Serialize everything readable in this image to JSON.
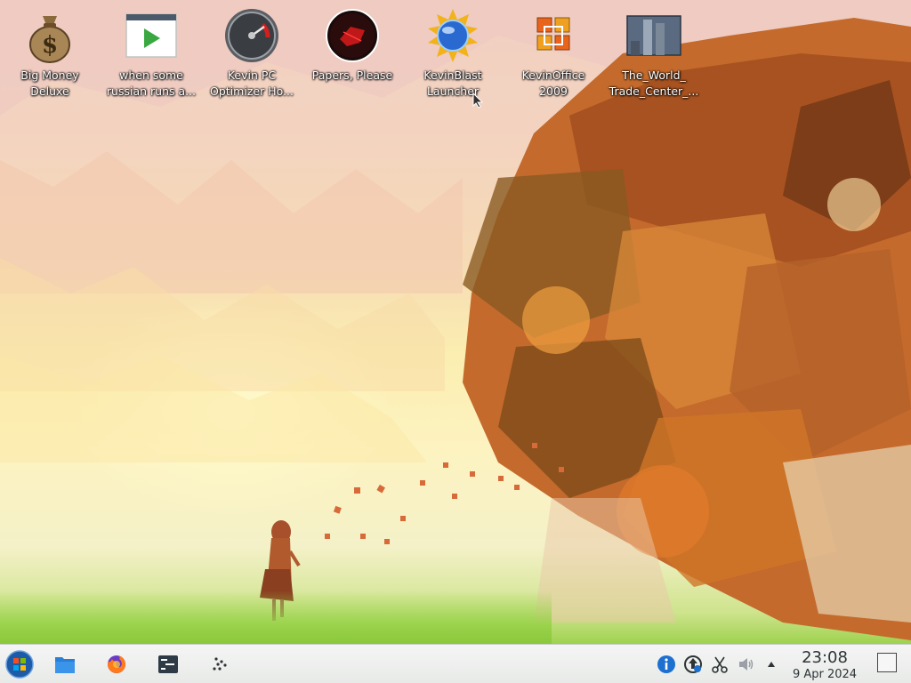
{
  "desktop": {
    "icons": [
      {
        "label": "Big Money\nDeluxe",
        "icon": "money-bag-icon"
      },
      {
        "label": "when some\nrussian runs a...",
        "icon": "video-file-icon"
      },
      {
        "label": "Kevin PC\nOptimizer Ho...",
        "icon": "gauge-icon"
      },
      {
        "label": "Papers, Please",
        "icon": "papers-please-icon"
      },
      {
        "label": "KevinBlast\nLauncher",
        "icon": "kevinblast-icon"
      },
      {
        "label": "KevinOffice\n2009",
        "icon": "office-icon"
      },
      {
        "label": "The_World_\nTrade_Center_...",
        "icon": "image-file-icon"
      }
    ]
  },
  "taskbar": {
    "start": {
      "icon": "start-orb-icon"
    },
    "launchers": [
      {
        "name": "File Manager",
        "icon": "folder-icon"
      },
      {
        "name": "Firefox",
        "icon": "firefox-icon"
      },
      {
        "name": "Terminal",
        "icon": "terminal-icon"
      },
      {
        "name": "Overview",
        "icon": "dots-icon"
      }
    ],
    "tray": [
      {
        "icon": "info-icon"
      },
      {
        "icon": "update-icon"
      },
      {
        "icon": "scissors-icon"
      },
      {
        "icon": "volume-icon"
      },
      {
        "icon": "tray-expand-icon"
      }
    ],
    "clock": {
      "time": "23:08",
      "date": "9 Apr 2024"
    }
  },
  "colors": {
    "taskbar_bg": "#ecedeb",
    "accent_blue": "#1d6fd0",
    "wallpaper_orange": "#c0622a"
  }
}
